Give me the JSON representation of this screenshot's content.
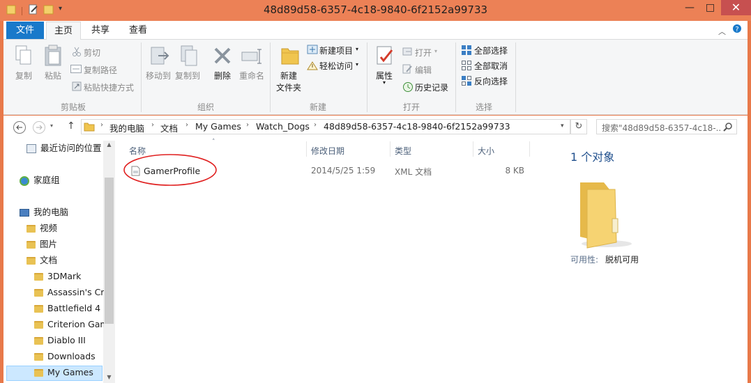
{
  "window": {
    "title": "48d89d58-6357-4c18-9840-6f2152a99733",
    "minimize_glyph": "—",
    "maximize_glyph": "□",
    "close_glyph": "✕"
  },
  "tabs": {
    "file": "文件",
    "home": "主页",
    "share": "共享",
    "view": "查看"
  },
  "ribbon": {
    "clipboard": {
      "group": "剪贴板",
      "copy": "复制",
      "paste": "粘贴",
      "cut": "剪切",
      "copy_path": "复制路径",
      "paste_shortcut": "粘贴快捷方式"
    },
    "organize": {
      "group": "组织",
      "move_to": "移动到",
      "copy_to": "复制到",
      "delete": "删除",
      "rename": "重命名"
    },
    "new": {
      "group": "新建",
      "new_folder": "新建\n文件夹",
      "new_folder_line1": "新建",
      "new_folder_line2": "文件夹",
      "new_item": "新建项目",
      "easy_access": "轻松访问"
    },
    "open": {
      "group": "打开",
      "properties": "属性",
      "open": "打开",
      "edit": "编辑",
      "history": "历史记录"
    },
    "select": {
      "group": "选择",
      "select_all": "全部选择",
      "select_none": "全部取消",
      "invert": "反向选择"
    }
  },
  "address": {
    "crumbs": [
      "我的电脑",
      "文档",
      "My Games",
      "Watch_Dogs",
      "48d89d58-6357-4c18-9840-6f2152a99733"
    ],
    "search_placeholder": "搜索\"48d89d58-6357-4c18-..."
  },
  "nav": {
    "recent": "最近访问的位置",
    "homegroup": "家庭组",
    "this_pc": "我的电脑",
    "videos": "视频",
    "pictures": "图片",
    "documents": "文档",
    "folders": [
      "3DMark",
      "Assassin's Cre",
      "Battlefield 4",
      "Criterion Gam",
      "Diablo III",
      "Downloads",
      "My Games"
    ]
  },
  "columns": {
    "name": "名称",
    "modified": "修改日期",
    "type": "类型",
    "size": "大小"
  },
  "files": [
    {
      "name": "GamerProfile",
      "modified": "2014/5/25 1:59",
      "type": "XML 文档",
      "size": "8 KB"
    }
  ],
  "details": {
    "count": "1 个对象",
    "availability_label": "可用性:",
    "availability_value": "脱机可用"
  },
  "colors": {
    "accent": "#1979ca",
    "titlebar": "#ec8156",
    "highlight": "#cce8ff",
    "annotation": "#e02020"
  }
}
